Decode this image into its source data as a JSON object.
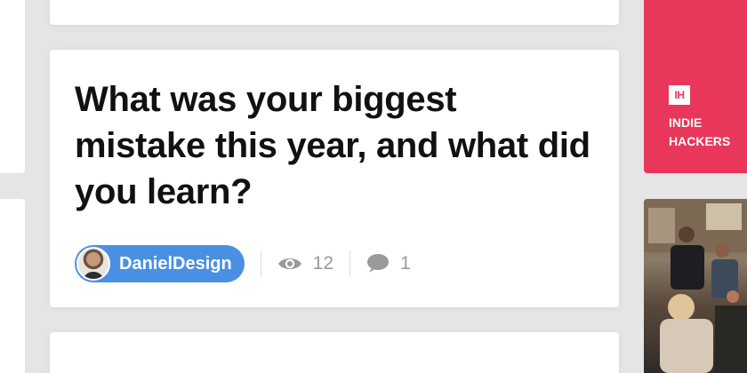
{
  "post": {
    "title": "What was your biggest mistake this year, and what did you learn?",
    "author": "DanielDesign",
    "views": "12",
    "comments": "1"
  },
  "sidebar": {
    "brand_logo": "IH",
    "brand_line1": "INDIE",
    "brand_line2": "HACKERS"
  },
  "colors": {
    "accent_blue": "#4a90e2",
    "brand_red": "#e8375a",
    "page_bg": "#e5e5e5"
  },
  "icons": [
    "eye-icon",
    "comment-icon",
    "ih-logo-icon"
  ]
}
